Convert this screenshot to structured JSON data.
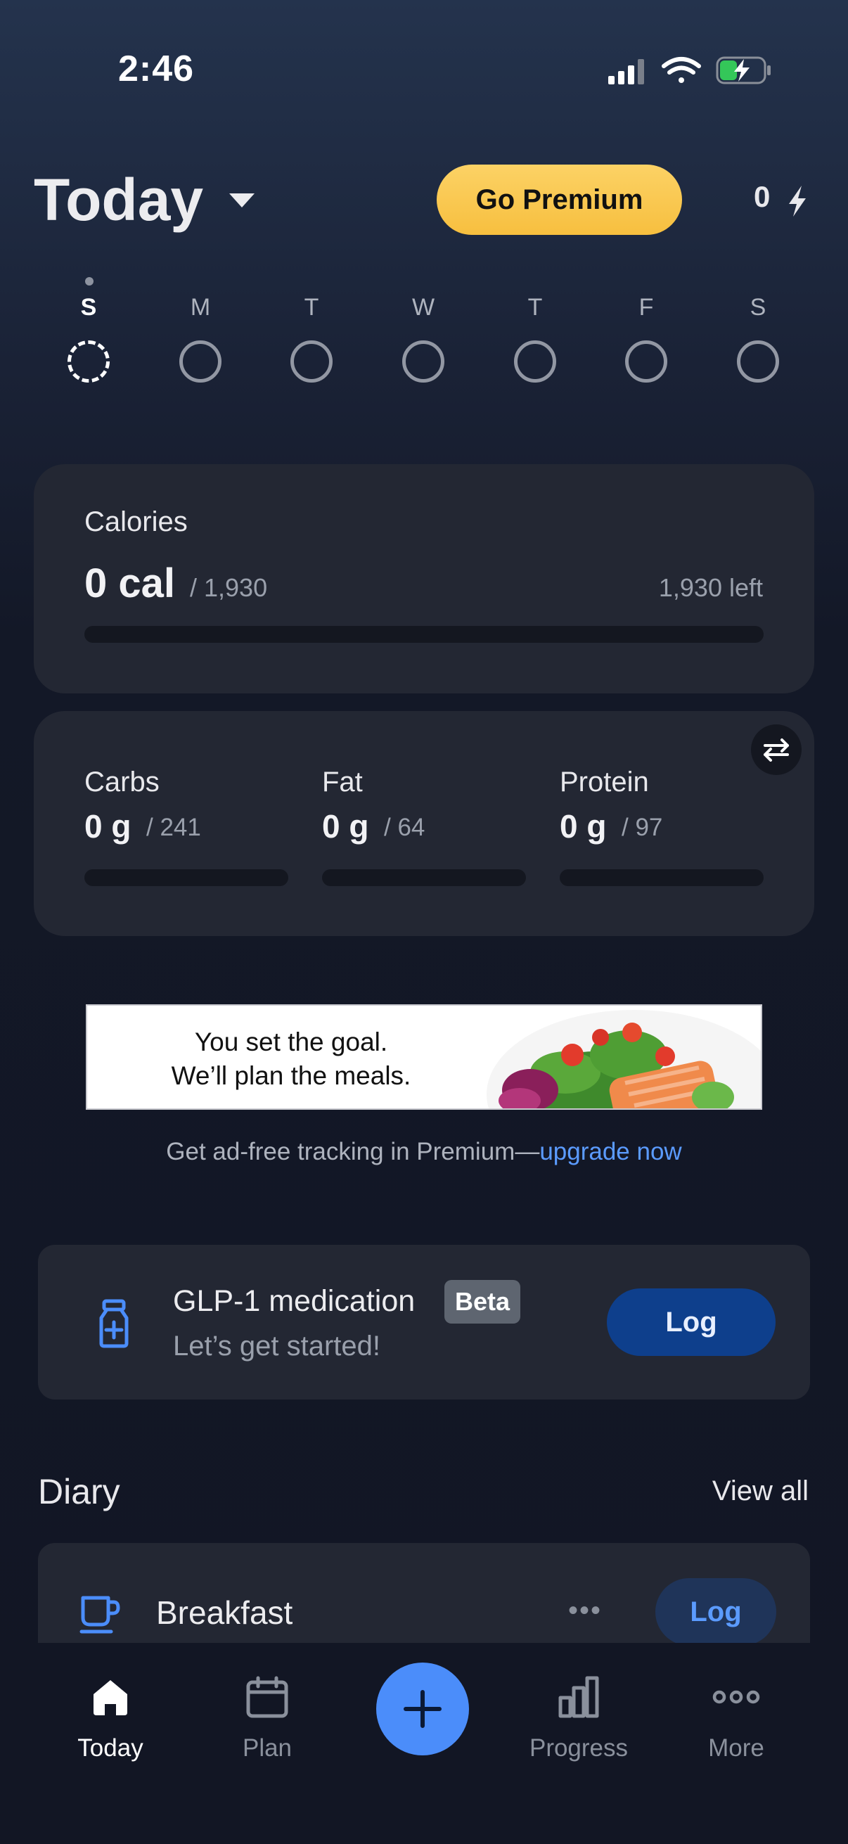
{
  "status_bar": {
    "time": "2:46"
  },
  "header": {
    "title": "Today",
    "premium_label": "Go Premium",
    "streak_count": "0"
  },
  "week": {
    "days": [
      "S",
      "M",
      "T",
      "W",
      "T",
      "F",
      "S"
    ],
    "active_index": 0
  },
  "calories": {
    "label": "Calories",
    "value": "0 cal",
    "goal": "/ 1,930",
    "left": "1,930 left",
    "progress": 0
  },
  "macros": [
    {
      "label": "Carbs",
      "value": "0 g",
      "goal": "/ 241",
      "progress": 0
    },
    {
      "label": "Fat",
      "value": "0 g",
      "goal": "/ 64",
      "progress": 0
    },
    {
      "label": "Protein",
      "value": "0 g",
      "goal": "/ 97",
      "progress": 0
    }
  ],
  "ad": {
    "line1": "You set the goal.",
    "line2": "We’ll plan the meals."
  },
  "promo": {
    "text": "Get ad-free tracking in Premium—",
    "link": "upgrade now"
  },
  "glp1": {
    "title": "GLP-1 medication",
    "badge": "Beta",
    "subtitle": "Let’s get started!",
    "log_label": "Log"
  },
  "diary": {
    "title": "Diary",
    "view_all": "View all",
    "meals": [
      {
        "label": "Breakfast",
        "more": "•••",
        "log_label": "Log"
      }
    ]
  },
  "tabbar": {
    "items": [
      {
        "label": "Today",
        "icon": "home-icon",
        "active": true
      },
      {
        "label": "Plan",
        "icon": "calendar-icon",
        "active": false
      },
      {
        "label": "Progress",
        "icon": "bar-chart-icon",
        "active": false
      },
      {
        "label": "More",
        "icon": "more-dots-icon",
        "active": false
      }
    ],
    "fab_icon": "plus-icon"
  },
  "colors": {
    "accent": "#4b8dfa",
    "premium": "#f9c84c",
    "card": "#232733",
    "background": "#131827"
  }
}
